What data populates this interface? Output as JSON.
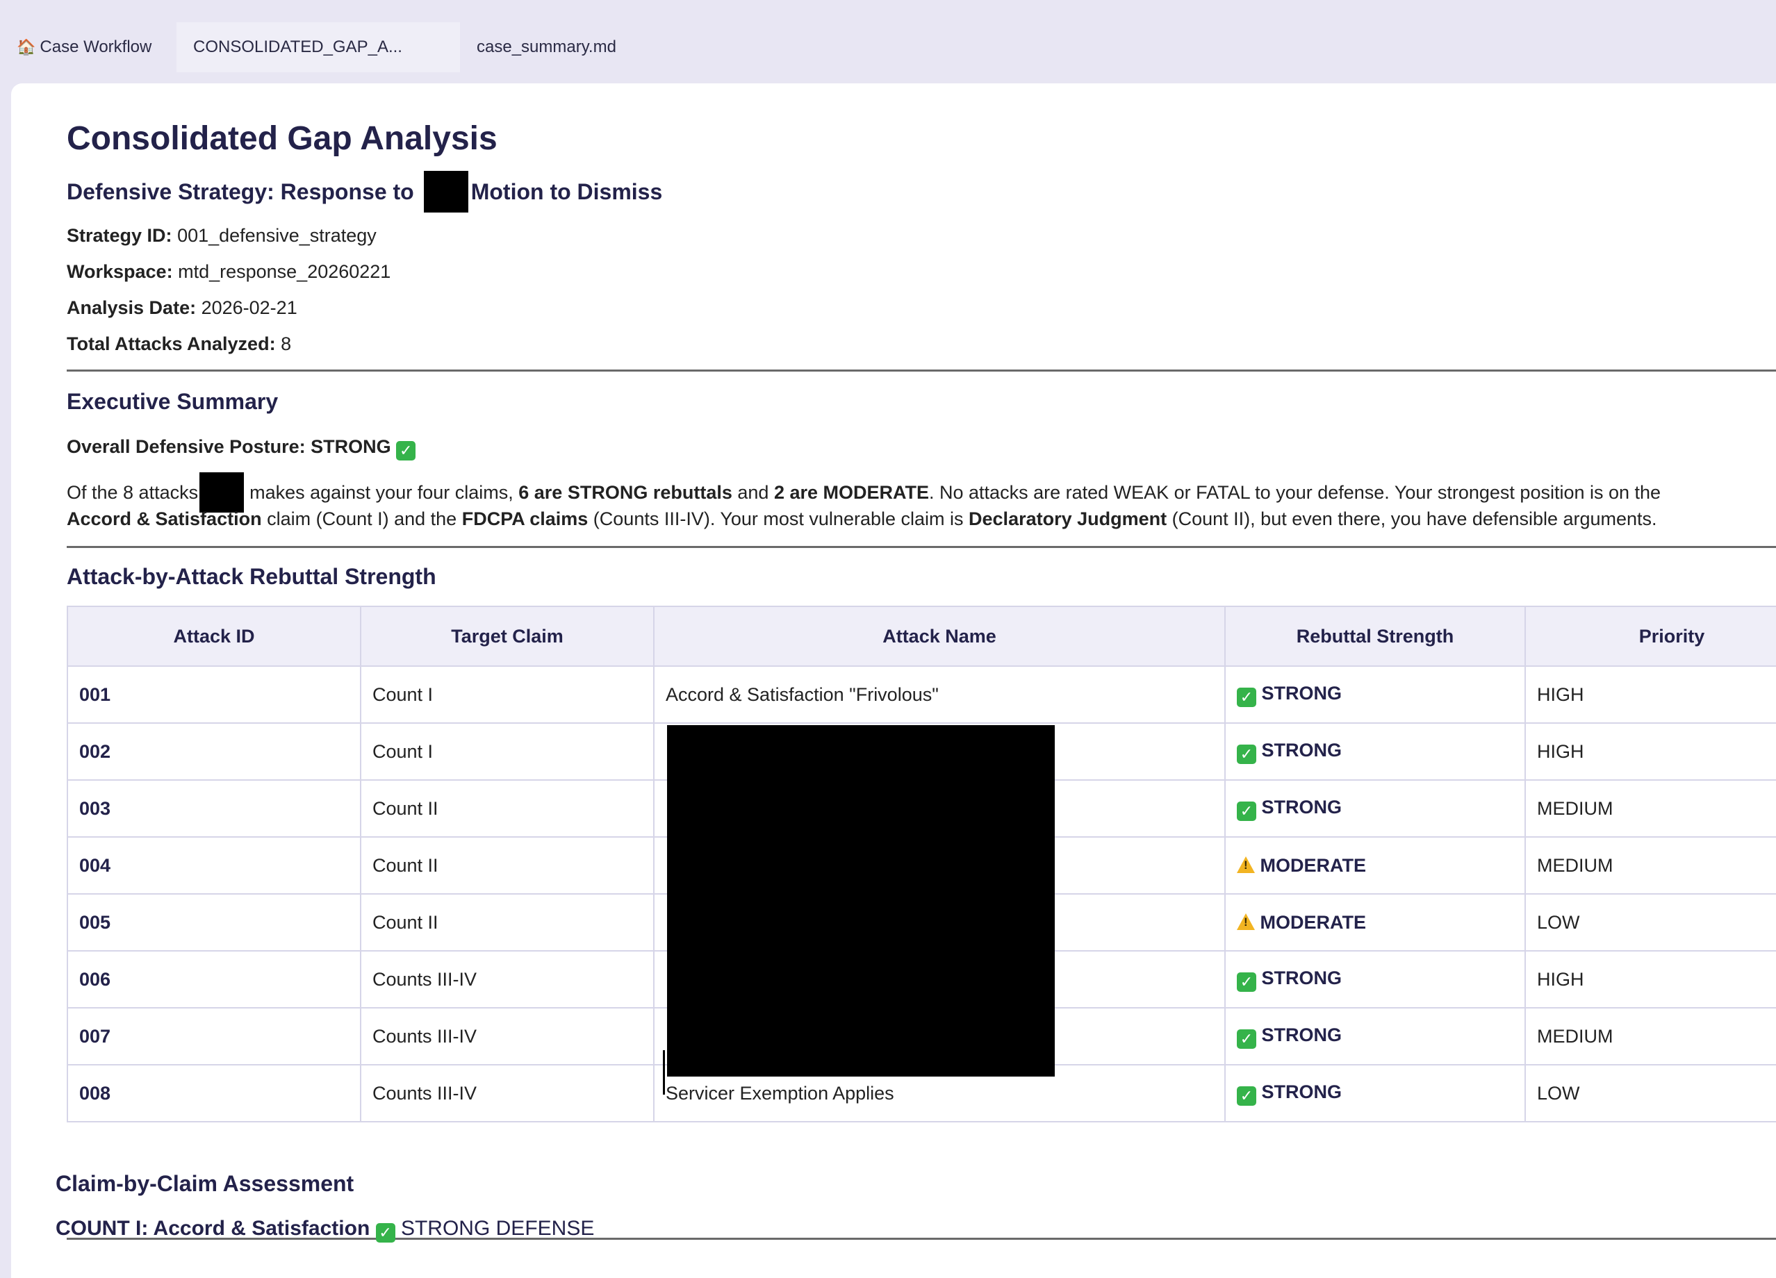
{
  "tabs": [
    {
      "icon": "house-icon",
      "label": "Case Workflow"
    },
    {
      "label": "CONSOLIDATED_GAP_A..."
    },
    {
      "label": "case_summary.md"
    }
  ],
  "doc": {
    "title": "Consolidated Gap Analysis",
    "subtitle_prefix": "Defensive Strategy: Response to",
    "subtitle_suffix": "Motion to Dismiss",
    "meta": [
      {
        "label": "Strategy ID:",
        "value": "001_defensive_strategy"
      },
      {
        "label": "Workspace:",
        "value": "mtd_response_20260221"
      },
      {
        "label": "Analysis Date:",
        "value": "2026-02-21"
      },
      {
        "label": "Total Attacks Analyzed:",
        "value": "8"
      }
    ],
    "exec": {
      "heading": "Executive Summary",
      "posture": "Overall Defensive Posture: STRONG",
      "line1_a": "Of the 8 attacks",
      "line1_b": "makes against your four claims,",
      "line1_c": "6 are STRONG rebuttals",
      "line1_d": "and",
      "line1_e": "2 are MODERATE",
      "line1_f": ". No attacks are rated WEAK or FATAL to your defense. Your strongest position is on the",
      "line2_a": "Accord & Satisfaction",
      "line2_b": "claim (Count I) and the",
      "line2_c": "FDCPA claims",
      "line2_d": "(Counts III-IV). Your most vulnerable claim is",
      "line2_e": "Declaratory Judgment",
      "line2_f": "(Count II), but even there, you have defensible arguments."
    },
    "attack_heading": "Attack-by-Attack Rebuttal Strength",
    "table": {
      "headers": [
        "Attack ID",
        "Target Claim",
        "Attack Name",
        "Rebuttal Strength",
        "Priority"
      ],
      "rows": [
        {
          "id": "001",
          "claim": "Count I",
          "name": "Accord & Satisfaction \"Frivolous\"",
          "strength": "STRONG",
          "icon": "check-icon",
          "priority": "HIGH"
        },
        {
          "id": "002",
          "claim": "Count I",
          "name": "",
          "strength": "STRONG",
          "icon": "check-icon",
          "priority": "HIGH"
        },
        {
          "id": "003",
          "claim": "Count II",
          "name": "",
          "strength": "STRONG",
          "icon": "check-icon",
          "priority": "MEDIUM"
        },
        {
          "id": "004",
          "claim": "Count II",
          "name": "",
          "strength": "MODERATE",
          "icon": "warning-icon",
          "priority": "MEDIUM"
        },
        {
          "id": "005",
          "claim": "Count II",
          "name": "",
          "strength": "MODERATE",
          "icon": "warning-icon",
          "priority": "LOW"
        },
        {
          "id": "006",
          "claim": "Counts III-IV",
          "name": "",
          "strength": "STRONG",
          "icon": "check-icon",
          "priority": "HIGH"
        },
        {
          "id": "007",
          "claim": "Counts III-IV",
          "name": "",
          "strength": "STRONG",
          "icon": "check-icon",
          "priority": "MEDIUM"
        },
        {
          "id": "008",
          "claim": "Counts III-IV",
          "name": "Servicer Exemption Applies",
          "strength": "STRONG",
          "icon": "check-icon",
          "priority": "LOW"
        }
      ]
    },
    "claim_heading": "Claim-by-Claim Assessment",
    "count1_label": "COUNT I: Accord & Satisfaction",
    "count1_status": "STRONG DEFENSE"
  },
  "colors": {
    "accent": "#23224a",
    "check": "#35b34a",
    "warning": "#f2b422"
  }
}
